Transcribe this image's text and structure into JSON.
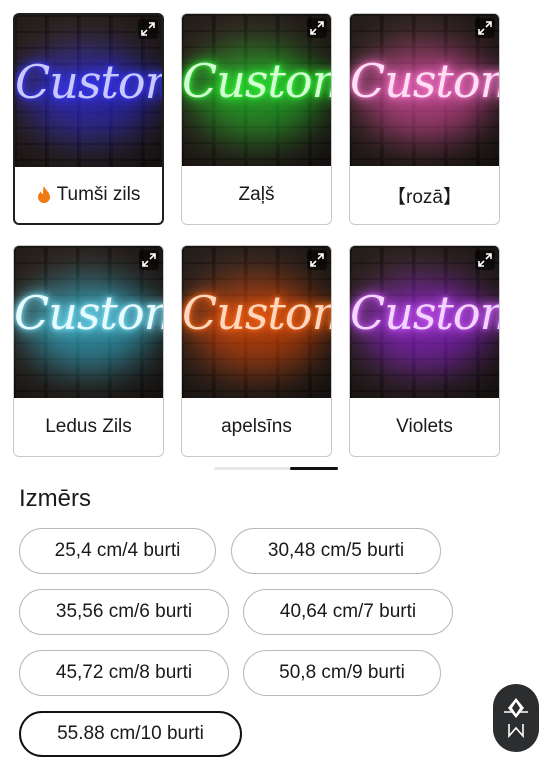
{
  "colors": {
    "items": [
      {
        "label": "Tumši zils",
        "neon_text": "Custom",
        "neon_color": "#3b3bff",
        "glow": "#2a2aff",
        "selected": true,
        "hot": true
      },
      {
        "label": "Zaļš",
        "neon_text": "Custom",
        "neon_color": "#34ff3a",
        "glow": "#1ddc2a",
        "selected": false,
        "hot": false
      },
      {
        "label": "【rozā】",
        "neon_text": "Custom",
        "neon_color": "#ff7ad2",
        "glow": "#ff4fb8",
        "selected": false,
        "hot": false
      },
      {
        "label": "Ledus Zils",
        "neon_text": "Custom",
        "neon_color": "#7ee6ff",
        "glow": "#2ccdf5",
        "selected": false,
        "hot": false
      },
      {
        "label": "apelsīns",
        "neon_text": "Custom",
        "neon_color": "#ff6a1a",
        "glow": "#ff4a00",
        "selected": false,
        "hot": false
      },
      {
        "label": "Violets",
        "neon_text": "Custom",
        "neon_color": "#d15cff",
        "glow": "#a21dff",
        "selected": false,
        "hot": false
      }
    ]
  },
  "size": {
    "title": "Izmērs",
    "options": [
      {
        "label": "25,4 cm/4 burti",
        "selected": false
      },
      {
        "label": "30,48 cm/5 burti",
        "selected": false
      },
      {
        "label": "35,56 cm/6 burti",
        "selected": false
      },
      {
        "label": "40,64 cm/7 burti",
        "selected": false
      },
      {
        "label": "45,72 cm/8 burti",
        "selected": false
      },
      {
        "label": "50,8 cm/9 burti",
        "selected": false
      },
      {
        "label": "55.88 cm/10 burti",
        "selected": true
      }
    ]
  },
  "icons": {
    "expand": "expand-icon",
    "hot": "fire-icon",
    "fab": "brand-logo-icon"
  }
}
